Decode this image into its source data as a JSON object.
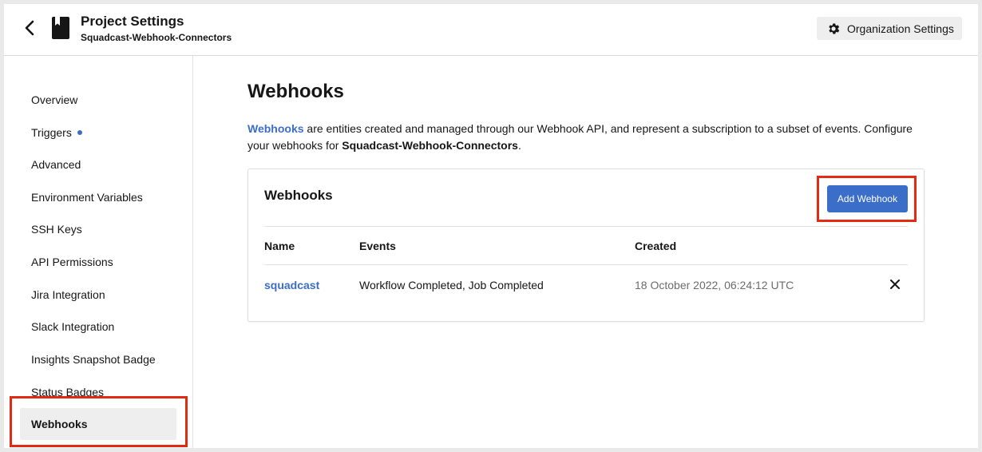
{
  "header": {
    "title": "Project Settings",
    "subtitle": "Squadcast-Webhook-Connectors",
    "org_settings_label": "Organization Settings"
  },
  "sidebar": {
    "items": [
      {
        "label": "Overview"
      },
      {
        "label": "Triggers"
      },
      {
        "label": "Advanced"
      },
      {
        "label": "Environment Variables"
      },
      {
        "label": "SSH Keys"
      },
      {
        "label": "API Permissions"
      },
      {
        "label": "Jira Integration"
      },
      {
        "label": "Slack Integration"
      },
      {
        "label": "Insights Snapshot Badge"
      },
      {
        "label": "Status Badges"
      },
      {
        "label": "Webhooks"
      }
    ],
    "active": "Webhooks"
  },
  "main": {
    "title": "Webhooks",
    "description": {
      "link_text": "Webhooks",
      "text_1": " are entities created and managed through our Webhook API, and represent a subscription to a subset of events. Configure your webhooks for ",
      "project_name": "Squadcast-Webhook-Connectors",
      "text_2": "."
    },
    "card": {
      "title": "Webhooks",
      "add_button_label": "Add Webhook",
      "columns": [
        "Name",
        "Events",
        "Created"
      ],
      "rows": [
        {
          "name": "squadcast",
          "events": "Workflow Completed, Job Completed",
          "created": "18 October 2022, 06:24:12 UTC"
        }
      ]
    }
  },
  "colors": {
    "accent": "#3b6ec9",
    "highlight": "#e32b13"
  },
  "icons": {
    "back": "chevron-left-icon",
    "project": "book-icon",
    "settings": "gear-icon",
    "delete": "close-icon"
  }
}
